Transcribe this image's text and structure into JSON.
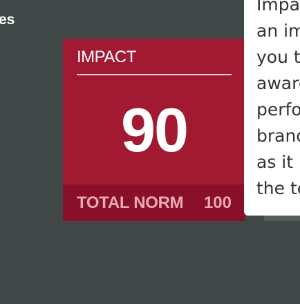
{
  "edge_label": "es",
  "card": {
    "title": "IMPACT",
    "score": "90",
    "footer": {
      "label": "TOTAL NORM",
      "value": "100"
    }
  },
  "tooltip": {
    "lines": [
      "Impac",
      "an im",
      "you t",
      "aware",
      "perfo",
      "branc",
      "as it i",
      "the te"
    ]
  },
  "colors": {
    "background": "#3f4846",
    "card": "#a11a31",
    "card_footer": "#8a0f28",
    "footer_text": "#e7a9b4",
    "tooltip": "#ffffff"
  }
}
